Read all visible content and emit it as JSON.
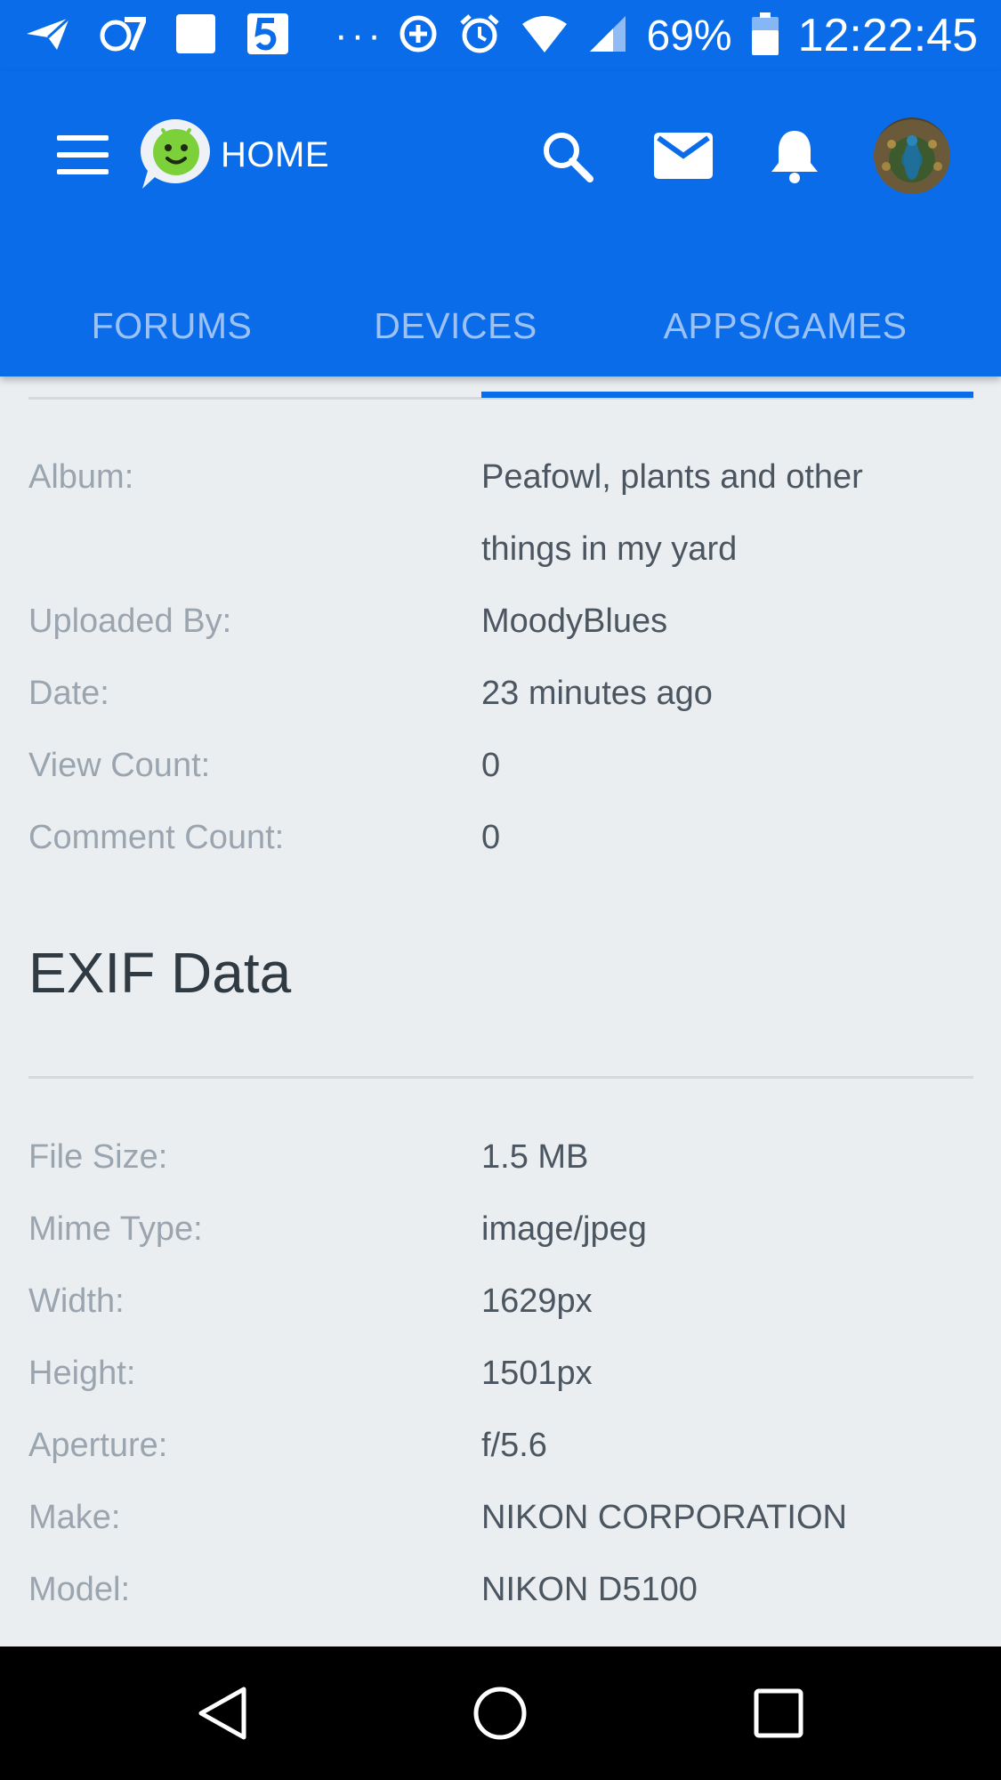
{
  "status_bar": {
    "battery": "69%",
    "time": "12:22:45",
    "overflow": "···",
    "icons": [
      "send-icon",
      "abc7-icon",
      "square-notification-icon",
      "channel5-icon",
      "sync-icon",
      "alarm-icon",
      "wifi-icon",
      "signal-icon",
      "battery-icon"
    ]
  },
  "app_bar": {
    "title": "HOME",
    "icons": [
      "menu-icon",
      "logo-icon",
      "search-icon",
      "mail-icon",
      "bell-icon",
      "avatar"
    ]
  },
  "tabs": [
    {
      "label": "FORUMS"
    },
    {
      "label": "DEVICES"
    },
    {
      "label": "APPS/GAMES"
    }
  ],
  "details": [
    {
      "label": "Album:",
      "value": "Peafowl, plants and other things in my yard"
    },
    {
      "label": "Uploaded By:",
      "value": "MoodyBlues"
    },
    {
      "label": "Date:",
      "value": "23 minutes ago"
    },
    {
      "label": "View Count:",
      "value": "0"
    },
    {
      "label": "Comment Count:",
      "value": "0"
    }
  ],
  "exif": {
    "title": "EXIF Data",
    "rows": [
      {
        "label": "File Size:",
        "value": "1.5 MB"
      },
      {
        "label": "Mime Type:",
        "value": "image/jpeg"
      },
      {
        "label": "Width:",
        "value": "1629px"
      },
      {
        "label": "Height:",
        "value": "1501px"
      },
      {
        "label": "Aperture:",
        "value": "f/5.6"
      },
      {
        "label": "Make:",
        "value": "NIKON CORPORATION"
      },
      {
        "label": "Model:",
        "value": "NIKON D5100"
      }
    ]
  },
  "colors": {
    "primary": "#0b6cea",
    "background": "#ebeef1",
    "label": "#9aa5af",
    "value": "#4b5660",
    "tab_text": "#9cc2f5"
  }
}
